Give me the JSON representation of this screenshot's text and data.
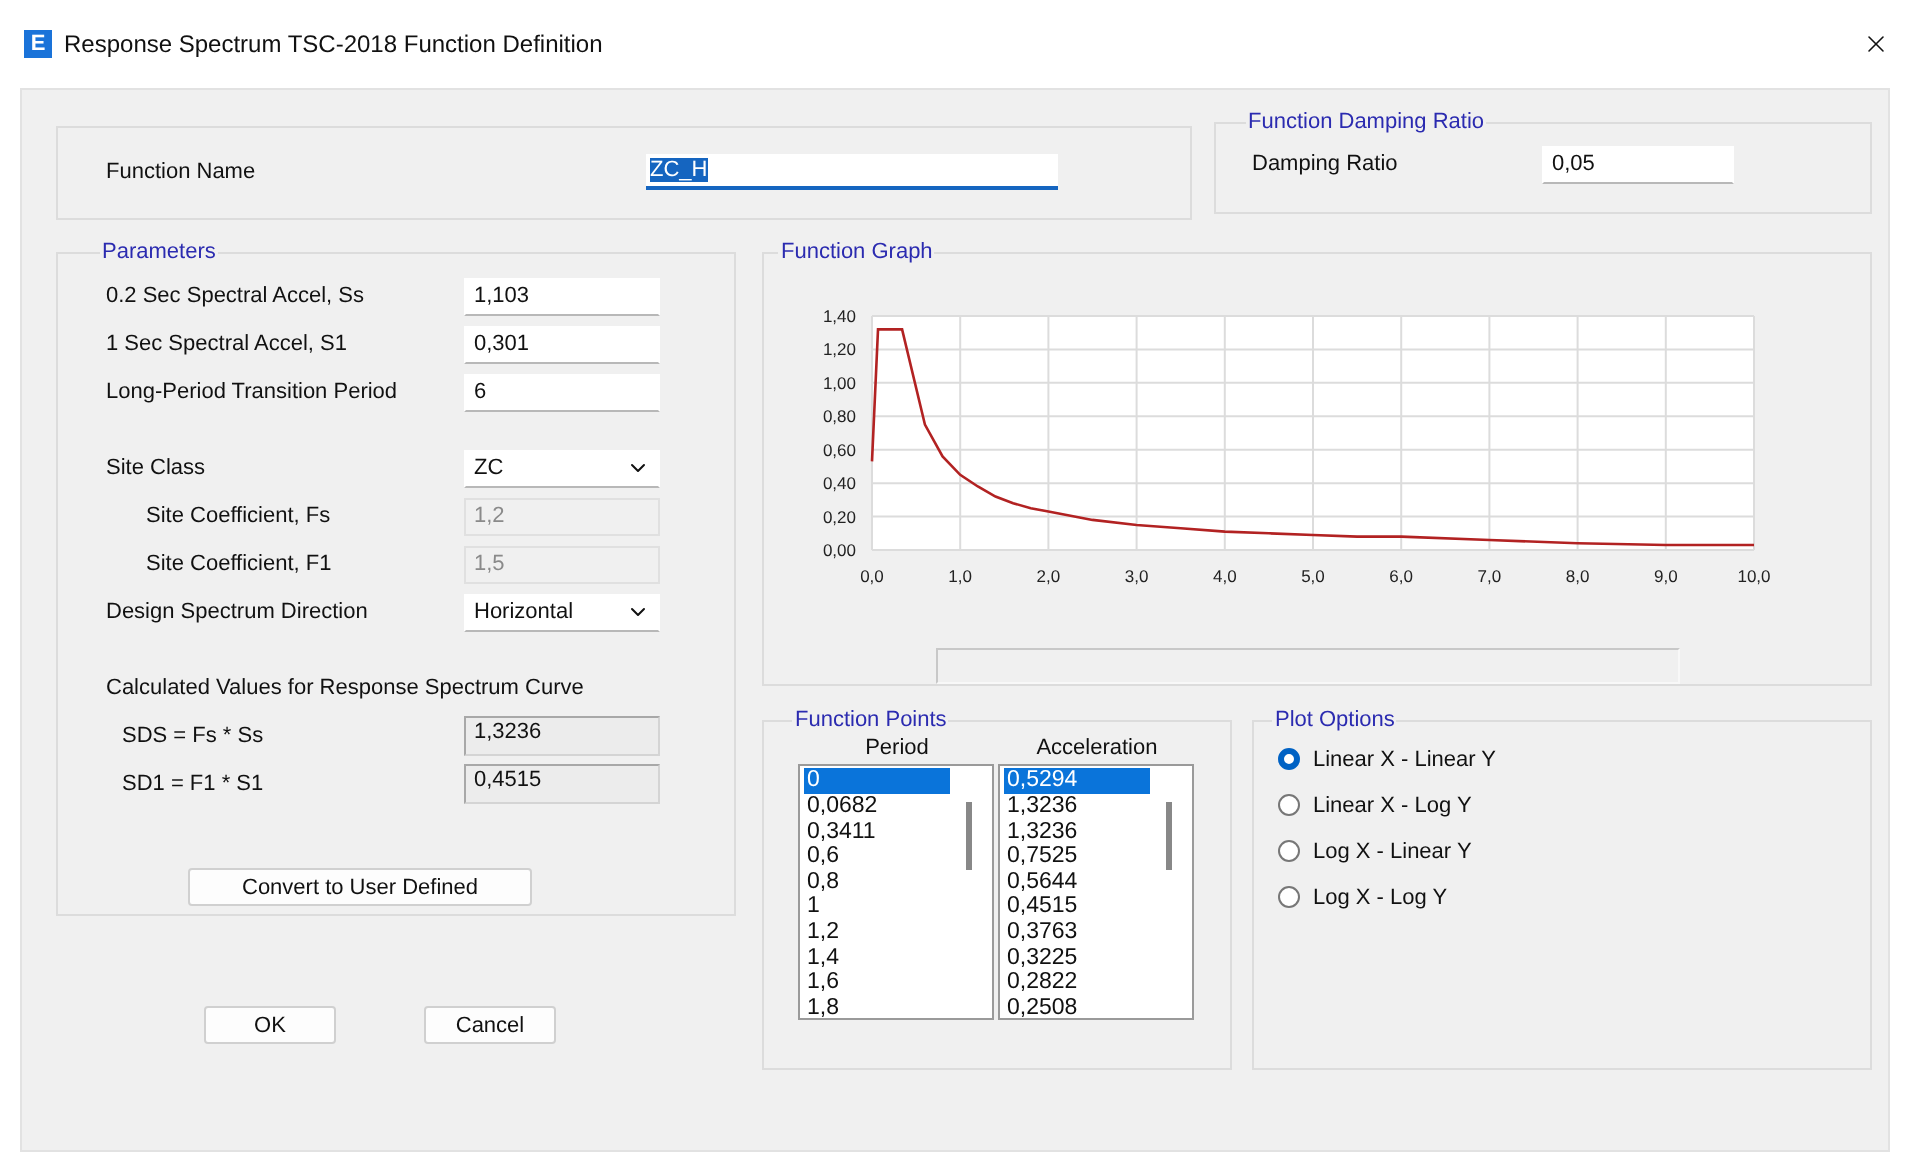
{
  "window": {
    "icon_letter": "E",
    "title": "Response Spectrum TSC-2018 Function Definition"
  },
  "function_name": {
    "label": "Function Name",
    "value": "ZC_H",
    "text_selected": true
  },
  "damping": {
    "title": "Function Damping Ratio",
    "label": "Damping Ratio",
    "value": "0,05"
  },
  "parameters": {
    "title": "Parameters",
    "groups": [
      [
        {
          "kind": "text",
          "label": "0.2 Sec Spectral Accel, Ss",
          "value": "1,103"
        },
        {
          "kind": "text",
          "label": "1 Sec Spectral Accel, S1",
          "value": "0,301"
        },
        {
          "kind": "text",
          "label": "Long-Period Transition Period",
          "value": "6"
        }
      ],
      [
        {
          "kind": "select",
          "label": "Site Class",
          "value": "ZC",
          "children": [
            {
              "kind": "text",
              "label": "Site Coefficient, Fs",
              "value": "1,2",
              "disabled": true
            },
            {
              "kind": "text",
              "label": "Site Coefficient, F1",
              "value": "1,5",
              "disabled": true
            }
          ]
        },
        {
          "kind": "select",
          "label": "Design Spectrum Direction",
          "value": "Horizontal"
        }
      ]
    ],
    "calculated": {
      "title": "Calculated Values for Response Spectrum Curve",
      "rows": [
        {
          "label": "SDS =  Fs * Ss",
          "value": "1,3236"
        },
        {
          "label": "SD1 =  F1 * S1",
          "value": "0,4515"
        }
      ]
    },
    "convert_button": "Convert to User Defined"
  },
  "buttons": [
    "OK",
    "Cancel"
  ],
  "graph": {
    "title": "Function Graph",
    "chart_data": {
      "type": "line",
      "x": [
        0,
        0.0682,
        0.3411,
        0.6,
        0.8,
        1,
        1.2,
        1.4,
        1.6,
        1.8,
        2,
        2.5,
        3,
        3.5,
        4,
        4.5,
        5,
        5.5,
        6,
        7,
        8,
        9,
        10
      ],
      "grid": true,
      "series": [
        {
          "color": "#b22222",
          "values": [
            0.53,
            1.32,
            1.32,
            0.75,
            0.56,
            0.45,
            0.38,
            0.32,
            0.28,
            0.25,
            0.23,
            0.18,
            0.15,
            0.13,
            0.11,
            0.1,
            0.09,
            0.08,
            0.08,
            0.06,
            0.04,
            0.03,
            0.03
          ]
        }
      ],
      "xlim": [
        0,
        10
      ],
      "ylim": [
        0,
        1.4
      ],
      "xticks": [
        {
          "value": 0,
          "label": "0,0"
        },
        {
          "value": 1,
          "label": "1,0"
        },
        {
          "value": 2,
          "label": "2,0"
        },
        {
          "value": 3,
          "label": "3,0"
        },
        {
          "value": 4,
          "label": "4,0"
        },
        {
          "value": 5,
          "label": "5,0"
        },
        {
          "value": 6,
          "label": "6,0"
        },
        {
          "value": 7,
          "label": "7,0"
        },
        {
          "value": 8,
          "label": "8,0"
        },
        {
          "value": 9,
          "label": "9,0"
        },
        {
          "value": 10,
          "label": "10,0"
        }
      ],
      "yticks": [
        {
          "value": 0,
          "label": "0,00"
        },
        {
          "value": 0.2,
          "label": "0,20"
        },
        {
          "value": 0.4,
          "label": "0,40"
        },
        {
          "value": 0.6,
          "label": "0,60"
        },
        {
          "value": 0.8,
          "label": "0,80"
        },
        {
          "value": 1,
          "label": "1,00"
        },
        {
          "value": 1.2,
          "label": "1,20"
        },
        {
          "value": 1.4,
          "label": "1,40"
        }
      ]
    }
  },
  "function_points": {
    "title": "Function Points",
    "columns": [
      {
        "header": "Period",
        "items": [
          {
            "text": "0",
            "selected": true
          },
          {
            "text": "0,0682",
            "selected": false
          },
          {
            "text": "0,3411",
            "selected": false
          },
          {
            "text": "0,6",
            "selected": false
          },
          {
            "text": "0,8",
            "selected": false
          },
          {
            "text": "1",
            "selected": false
          },
          {
            "text": "1,2",
            "selected": false
          },
          {
            "text": "1,4",
            "selected": false
          },
          {
            "text": "1,6",
            "selected": false
          },
          {
            "text": "1,8",
            "selected": false
          }
        ]
      },
      {
        "header": "Acceleration",
        "items": [
          {
            "text": "0,5294",
            "selected": true
          },
          {
            "text": "1,3236",
            "selected": false
          },
          {
            "text": "1,3236",
            "selected": false
          },
          {
            "text": "0,7525",
            "selected": false
          },
          {
            "text": "0,5644",
            "selected": false
          },
          {
            "text": "0,4515",
            "selected": false
          },
          {
            "text": "0,3763",
            "selected": false
          },
          {
            "text": "0,3225",
            "selected": false
          },
          {
            "text": "0,2822",
            "selected": false
          },
          {
            "text": "0,2508",
            "selected": false
          }
        ]
      }
    ]
  },
  "plot_options": {
    "title": "Plot Options",
    "options": [
      {
        "label": "Linear X - Linear Y",
        "selected": true
      },
      {
        "label": "Linear X - Log Y",
        "selected": false
      },
      {
        "label": "Log X - Linear Y",
        "selected": false
      },
      {
        "label": "Log X - Log Y",
        "selected": false
      }
    ]
  }
}
